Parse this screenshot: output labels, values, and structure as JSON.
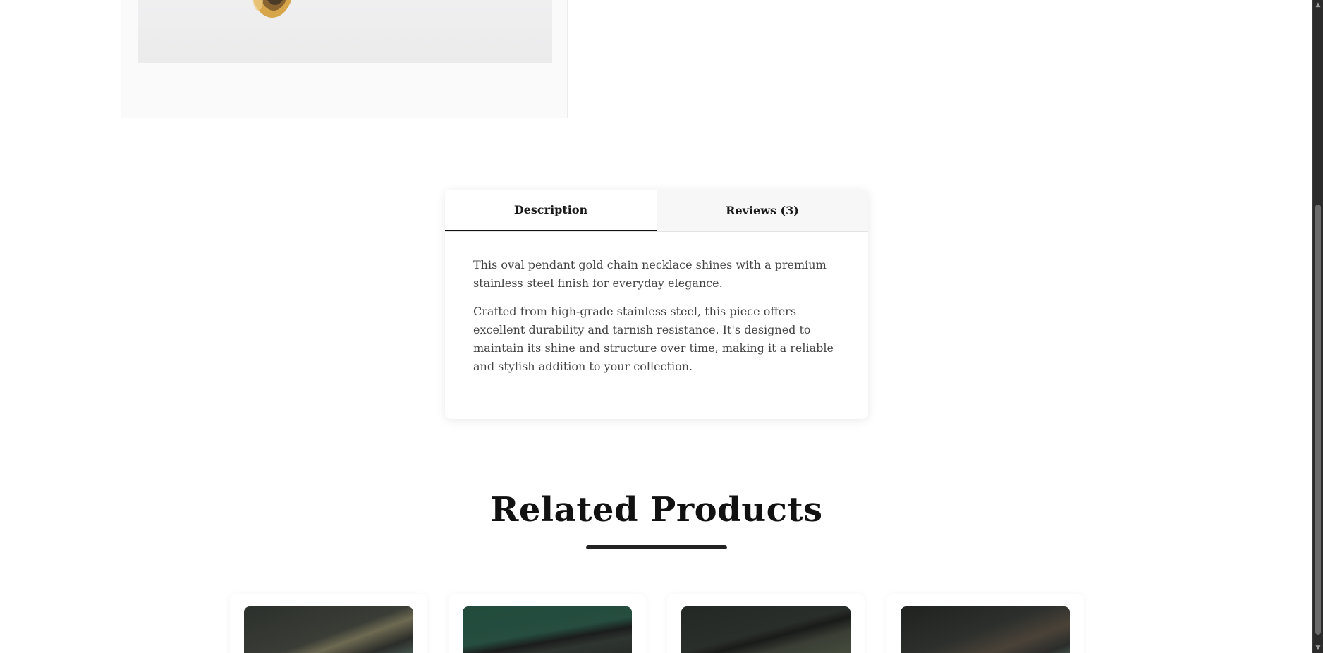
{
  "tabs": [
    {
      "label": "Description",
      "active": true
    },
    {
      "label": "Reviews (3)",
      "active": false
    }
  ],
  "description": {
    "paragraphs": [
      "This oval pendant gold chain necklace shines with a premium stainless steel finish for everyday elegance.",
      "Crafted from high-grade stainless steel, this piece offers excellent durability and tarnish resistance. It's designed to maintain its shine and structure over time, making it a reliable and stylish addition to your collection."
    ]
  },
  "related": {
    "title": "Related Products"
  },
  "icons": {
    "scroll_up": "chevron-up-icon",
    "scroll_down": "chevron-down-icon"
  },
  "colors": {
    "accent": "#111111",
    "tab_inactive_bg": "#f7f7f7",
    "scrollbar_bg": "#2b2b2b"
  }
}
